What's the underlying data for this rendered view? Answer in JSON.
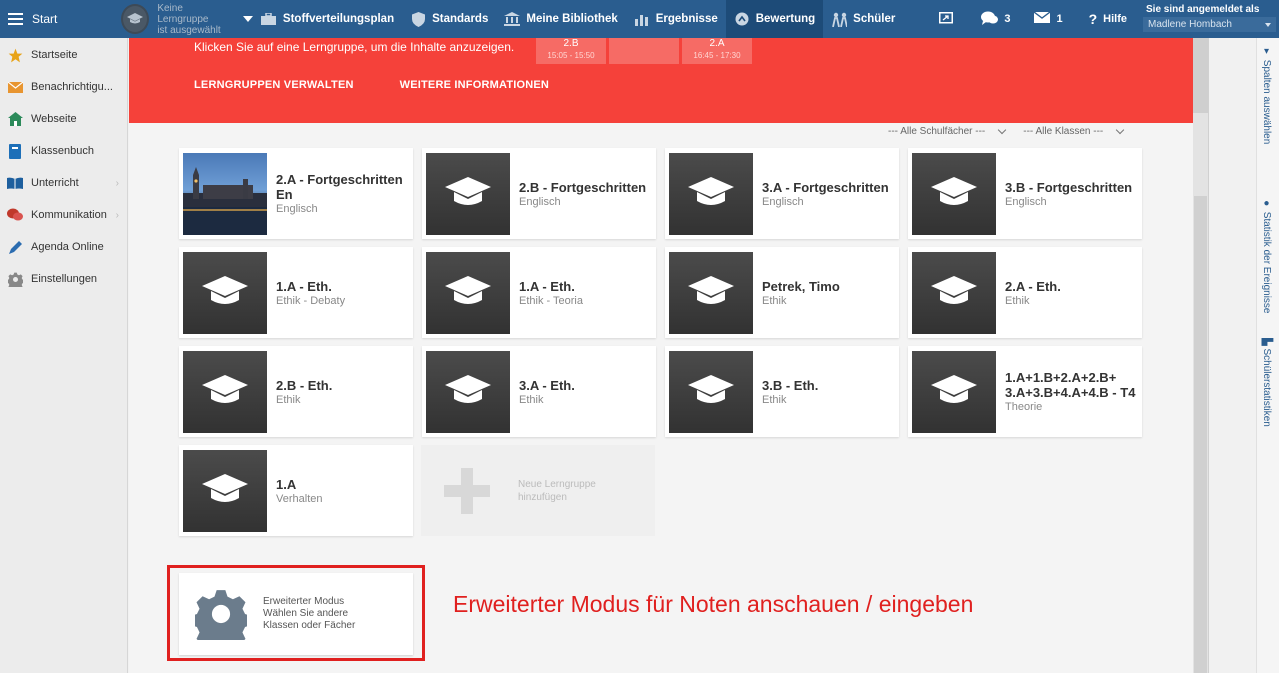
{
  "topbar": {
    "start_label": "Start",
    "learning_group_line1": "Keine Lerngruppe",
    "learning_group_line2": "ist ausgewählt",
    "nav": [
      {
        "label": "Stoffverteilungsplan",
        "icon": "briefcase-icon"
      },
      {
        "label": "Standards",
        "icon": "shield-icon"
      },
      {
        "label": "Meine Bibliothek",
        "icon": "library-icon"
      },
      {
        "label": "Ergebnisse",
        "icon": "bar-chart-icon"
      },
      {
        "label": "Bewertung",
        "icon": "rating-icon",
        "active": true
      },
      {
        "label": "Schüler",
        "icon": "students-icon"
      }
    ],
    "screen_icon": "screen-share-icon",
    "chat_count": "3",
    "mail_count": "1",
    "help_label": "Hilfe",
    "logged_in_label": "Sie sind angemeldet als",
    "user_name": "Madlene Hombach"
  },
  "sidebar": {
    "items": [
      {
        "label": "Startseite",
        "icon": "star-icon"
      },
      {
        "label": "Benachrichtigu...",
        "icon": "envelope-icon"
      },
      {
        "label": "Webseite",
        "icon": "home-icon"
      },
      {
        "label": "Klassenbuch",
        "icon": "book-icon"
      },
      {
        "label": "Unterricht",
        "icon": "open-book-icon",
        "has_arrow": true
      },
      {
        "label": "Kommunikation",
        "icon": "chat-icon",
        "has_arrow": true
      },
      {
        "label": "Agenda Online",
        "icon": "pen-icon"
      },
      {
        "label": "Einstellungen",
        "icon": "gear-icon"
      }
    ]
  },
  "banner": {
    "text": "Klicken Sie auf eine Lerngruppe, um die Inhalte anzuzeigen.",
    "timeslots": [
      {
        "label": "2.B",
        "time": "15:05 - 15:50"
      },
      {
        "label": "",
        "time": ""
      },
      {
        "label": "2.A",
        "time": "16:45 - 17:30"
      }
    ],
    "links": [
      "LERNGRUPPEN VERWALTEN",
      "WEITERE INFORMATIONEN"
    ]
  },
  "filters": {
    "subjects": "--- Alle Schulfächer ---",
    "classes": "--- Alle Klassen ---"
  },
  "cards": [
    {
      "title": "2.A - Fortgeschritten En",
      "subject": "Englisch",
      "photo": true
    },
    {
      "title": "2.B - Fortgeschritten",
      "subject": "Englisch"
    },
    {
      "title": "3.A - Fortgeschritten",
      "subject": "Englisch"
    },
    {
      "title": "3.B - Fortgeschritten",
      "subject": "Englisch"
    },
    {
      "title": "1.A - Eth.",
      "subject": "Ethik - Debaty"
    },
    {
      "title": "1.A - Eth.",
      "subject": "Ethik - Teoria"
    },
    {
      "title": "Petrek, Timo",
      "subject": "Ethik"
    },
    {
      "title": "2.A - Eth.",
      "subject": "Ethik"
    },
    {
      "title": "2.B - Eth.",
      "subject": "Ethik"
    },
    {
      "title": "3.A - Eth.",
      "subject": "Ethik"
    },
    {
      "title": "3.B - Eth.",
      "subject": "Ethik"
    },
    {
      "title": "1.A+1.B+2.A+2.B+ 3.A+3.B+4.A+4.B - T4",
      "subject": "Theorie"
    },
    {
      "title": "1.A",
      "subject": "Verhalten"
    }
  ],
  "new_group": {
    "line1": "Neue Lerngruppe",
    "line2": "hinzufügen"
  },
  "extended_mode": {
    "line1": "Erweiterter Modus",
    "line2": "Wählen Sie andere",
    "line3": "Klassen oder Fächer",
    "annotation": "Erweiterter Modus für Noten anschauen / eingeben"
  },
  "right_rail": {
    "columns": "Spalten auswählen",
    "stats_events": "Statistik der Ereignisse",
    "student_stats": "Schülerstatistiken"
  }
}
